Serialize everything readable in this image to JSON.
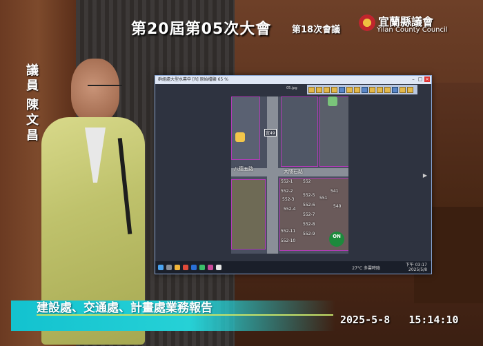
{
  "overlay": {
    "session_title": "第20屆第05次大會",
    "meeting": "第18次會議",
    "council_name": "宜蘭縣議會",
    "council_name_en": "Yilan County Council",
    "speaker_role": "議員",
    "speaker_name": "陳文昌",
    "agenda": "建設處、交通處、計畫處業務報告",
    "date": "2025-5-8",
    "time": "15:14:10"
  },
  "screen": {
    "window_title": "群組處大型水幕中 [R] 原始檔顯 65 %",
    "document_name": "05.jpg",
    "map": {
      "road_tag": "宜49",
      "road_labels": [
        "大隱石路",
        "八德五路"
      ],
      "parcels": [
        "552-1",
        "552",
        "552-2",
        "552-3",
        "552-4",
        "552-5",
        "552-6",
        "552-7",
        "552-8",
        "552-9",
        "552-10",
        "552-11",
        "551",
        "541",
        "540"
      ],
      "on_badge": "ON"
    },
    "taskbar": {
      "weather": "27°C 多雲時陰",
      "clock_time": "下午 03:17",
      "clock_date": "2025/5/8"
    }
  }
}
